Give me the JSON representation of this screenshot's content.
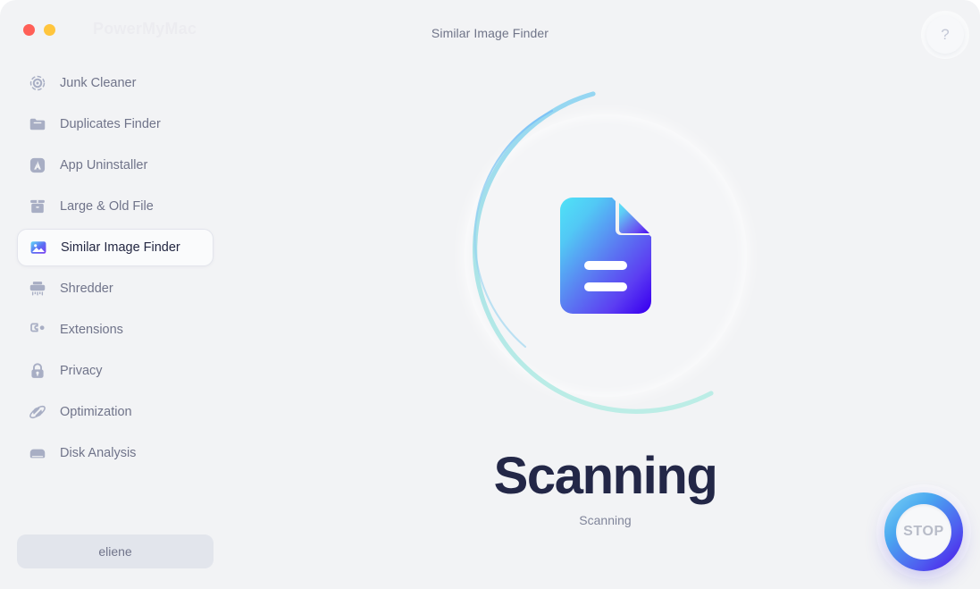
{
  "window": {
    "brand": "PowerMyMac",
    "title": "Similar Image Finder",
    "help_label": "?",
    "traffic_lights": [
      {
        "name": "close",
        "color": "#ff5f57"
      },
      {
        "name": "minimize",
        "color": "#ffc53d"
      }
    ]
  },
  "sidebar": {
    "items": [
      {
        "label": "Junk Cleaner",
        "icon": "target-icon",
        "active": false
      },
      {
        "label": "Duplicates Finder",
        "icon": "folder-icon",
        "active": false
      },
      {
        "label": "App Uninstaller",
        "icon": "app-box-icon",
        "active": false
      },
      {
        "label": "Large & Old File",
        "icon": "archive-box-icon",
        "active": false
      },
      {
        "label": "Similar Image Finder",
        "icon": "photo-icon",
        "active": true
      },
      {
        "label": "Shredder",
        "icon": "shredder-icon",
        "active": false
      },
      {
        "label": "Extensions",
        "icon": "puzzle-icon",
        "active": false
      },
      {
        "label": "Privacy",
        "icon": "lock-icon",
        "active": false
      },
      {
        "label": "Optimization",
        "icon": "optimization-icon",
        "active": false
      },
      {
        "label": "Disk Analysis",
        "icon": "disk-icon",
        "active": false
      }
    ],
    "user_button": "eliene"
  },
  "main": {
    "status_heading": "Scanning",
    "status_subtitle": "Scanning",
    "center_icon": "document-icon",
    "progress": {
      "track_visible": true,
      "outer_arc_color": "#a8e6e0",
      "inner_arc_color": "#7ec4f5"
    },
    "stop_button": {
      "label": "STOP",
      "gradient_from": "#7fd4f5",
      "gradient_to": "#4b12e8"
    }
  },
  "colors": {
    "background": "#f2f3f5",
    "text_primary": "#232747",
    "text_secondary": "#70748a",
    "icon_muted": "#a8aec4",
    "accent_blue": "#4f5ef0",
    "accent_cyan": "#5ad8f0"
  }
}
